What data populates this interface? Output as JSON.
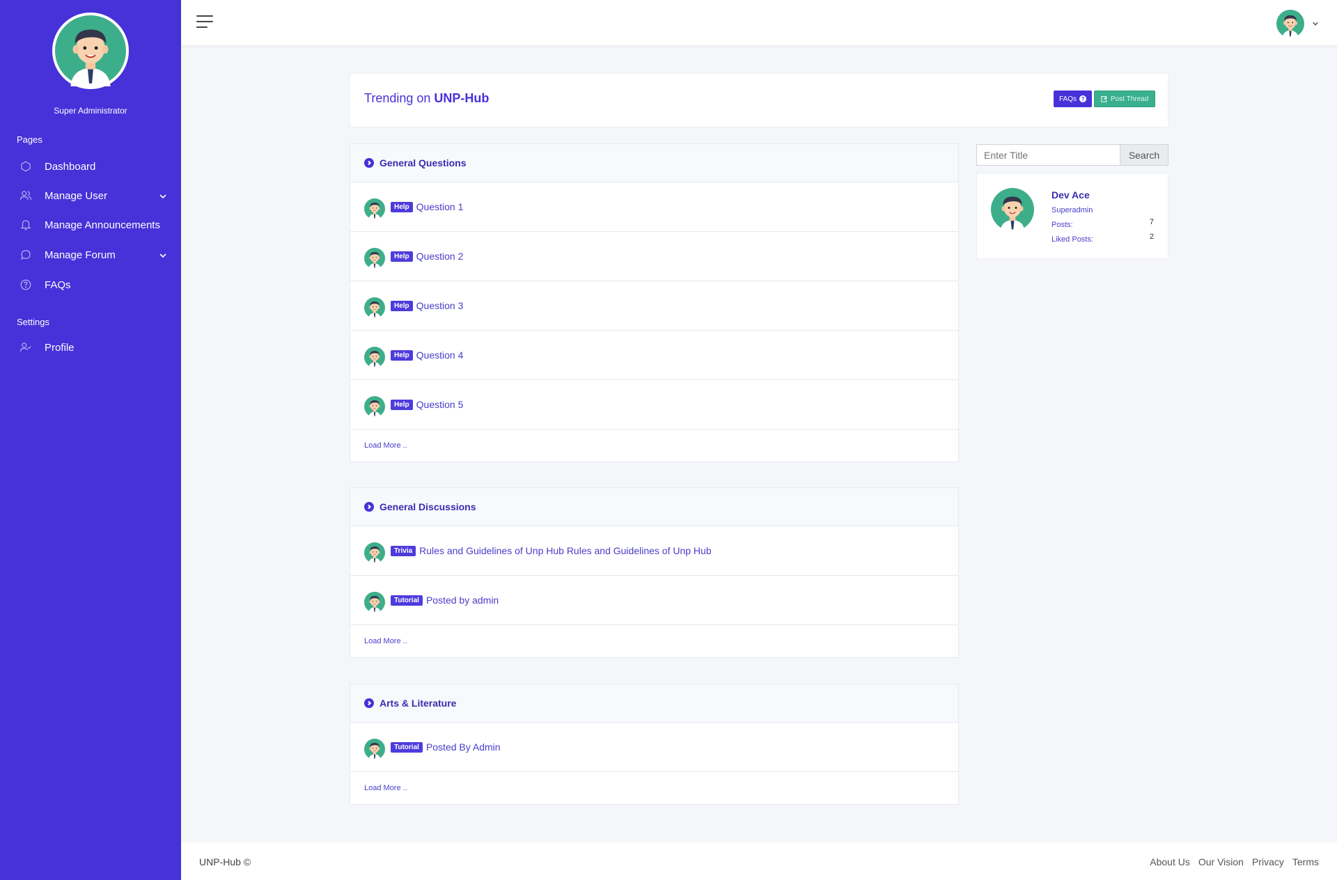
{
  "sidebar": {
    "role": "Super Administrator",
    "section_pages": "Pages",
    "section_settings": "Settings",
    "items": [
      {
        "label": "Dashboard",
        "icon": "hexagon-icon"
      },
      {
        "label": "Manage User",
        "icon": "users-icon",
        "expandable": true
      },
      {
        "label": "Manage Announcements",
        "icon": "bell-icon"
      },
      {
        "label": "Manage Forum",
        "icon": "chat-icon",
        "expandable": true
      },
      {
        "label": "FAQs",
        "icon": "help-circle-icon"
      },
      {
        "label": "Profile",
        "icon": "user-check-icon"
      }
    ]
  },
  "header": {
    "trending_prefix": "Trending on ",
    "trending_brand": "UNP-Hub",
    "faqs_label": "FAQs",
    "post_label": "Post Thread"
  },
  "categories": [
    {
      "title": "General Questions",
      "threads": [
        {
          "badge": "Help",
          "title": "Question 1"
        },
        {
          "badge": "Help",
          "title": "Question 2"
        },
        {
          "badge": "Help",
          "title": "Question 3"
        },
        {
          "badge": "Help",
          "title": "Question 4"
        },
        {
          "badge": "Help",
          "title": "Question 5"
        }
      ],
      "load_more": "Load More .."
    },
    {
      "title": "General Discussions",
      "threads": [
        {
          "badge": "Trivia",
          "title": "Rules and Guidelines of Unp Hub Rules and Guidelines of Unp Hub"
        },
        {
          "badge": "Tutorial",
          "title": "Posted by admin"
        }
      ],
      "load_more": "Load More .."
    },
    {
      "title": "Arts & Literature",
      "threads": [
        {
          "badge": "Tutorial",
          "title": "Posted By Admin"
        }
      ],
      "load_more": "Load More .."
    }
  ],
  "search": {
    "placeholder": "Enter Title",
    "button": "Search"
  },
  "profile": {
    "name": "Dev Ace",
    "role": "Superadmin",
    "posts_label": "Posts:",
    "posts_value": "7",
    "liked_label": "Liked Posts:",
    "liked_value": "2"
  },
  "footer": {
    "brand": "UNP-Hub ©",
    "links": [
      "About Us",
      "Our Vision",
      "Privacy",
      "Terms"
    ]
  },
  "colors": {
    "sidebar": "#4731d8",
    "accent": "#4731d8",
    "success": "#3bb08f",
    "avatar_bg": "#3dae8a"
  }
}
